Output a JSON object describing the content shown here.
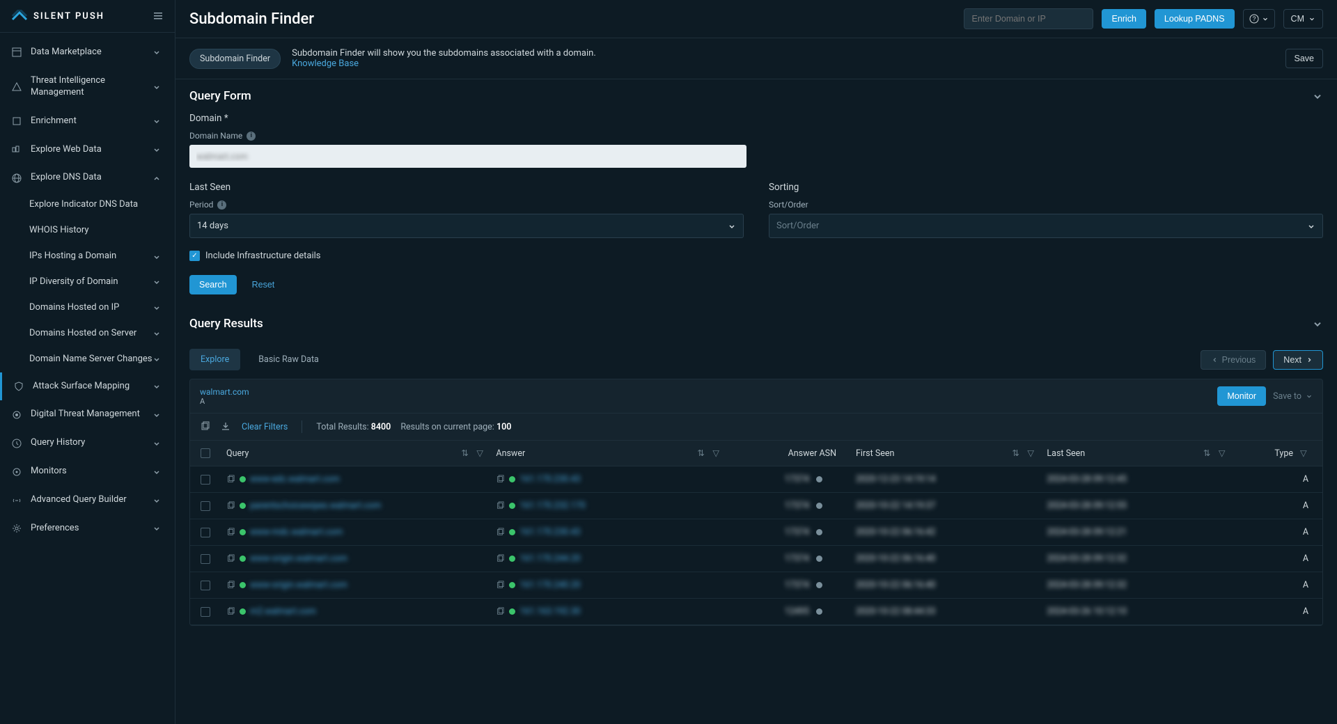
{
  "brand": "SILENT PUSH",
  "header": {
    "title": "Subdomain Finder",
    "search_placeholder": "Enter Domain or IP",
    "enrich": "Enrich",
    "lookup": "Lookup PADNS",
    "user": "CM"
  },
  "sidebar": {
    "items": [
      {
        "label": "Data Marketplace"
      },
      {
        "label": "Threat Intelligence Management"
      },
      {
        "label": "Enrichment"
      },
      {
        "label": "Explore Web Data"
      },
      {
        "label": "Explore DNS Data",
        "expanded": true,
        "children": [
          {
            "label": "Explore Indicator DNS Data"
          },
          {
            "label": "WHOIS History"
          },
          {
            "label": "IPs Hosting a Domain"
          },
          {
            "label": "IP Diversity of Domain"
          },
          {
            "label": "Domains Hosted on IP"
          },
          {
            "label": "Domains Hosted on Server"
          },
          {
            "label": "Domain Name Server Changes"
          }
        ]
      },
      {
        "label": "Attack Surface Mapping"
      },
      {
        "label": "Digital Threat Management"
      },
      {
        "label": "Query History"
      },
      {
        "label": "Monitors"
      },
      {
        "label": "Advanced Query Builder"
      },
      {
        "label": "Preferences"
      }
    ]
  },
  "info": {
    "pill": "Subdomain Finder",
    "text": "Subdomain Finder will show you the subdomains associated with a domain.",
    "kb": "Knowledge Base",
    "save": "Save"
  },
  "form": {
    "head": "Query Form",
    "domain_group": "Domain *",
    "domain_label": "Domain Name",
    "domain_value": "walmart.com",
    "last_seen_group": "Last Seen",
    "period_label": "Period",
    "period_value": "14 days",
    "sorting_group": "Sorting",
    "sort_label": "Sort/Order",
    "sort_placeholder": "Sort/Order",
    "include_infra": "Include Infrastructure details",
    "search": "Search",
    "reset": "Reset"
  },
  "results": {
    "head": "Query Results",
    "tabs": {
      "explore": "Explore",
      "raw": "Basic Raw Data"
    },
    "pager": {
      "prev": "Previous",
      "next": "Next"
    },
    "query_domain": "walmart.com",
    "query_type": "A",
    "monitor": "Monitor",
    "saveto": "Save to",
    "clear_filters": "Clear Filters",
    "total_label": "Total Results:",
    "total_value": "8400",
    "page_label": "Results on current page:",
    "page_value": "100",
    "columns": {
      "query": "Query",
      "answer": "Answer",
      "asn": "Answer ASN",
      "first": "First Seen",
      "last": "Last Seen",
      "type": "Type"
    },
    "rows": [
      {
        "query": "www-edc.walmart.com",
        "answer": "161.170.230.43",
        "asn": "17374",
        "first": "2020-12-23 14:19:14",
        "last": "2024-03-28 09:12:45",
        "type": "A"
      },
      {
        "query": "parentschoicewipes.walmart.com",
        "answer": "161.170.232.170",
        "asn": "17374",
        "first": "2020-10-22 14:19:37",
        "last": "2024-03-28 09:12:55",
        "type": "A"
      },
      {
        "query": "www-mdc.walmart.com",
        "answer": "161.170.230.43",
        "asn": "17374",
        "first": "2020-10-22 06:16:42",
        "last": "2024-03-28 09:12:21",
        "type": "A"
      },
      {
        "query": "www-origin.walmart.com",
        "answer": "161.170.244.20",
        "asn": "17374",
        "first": "2020-10-22 06:16:40",
        "last": "2024-03-28 09:12:32",
        "type": "A"
      },
      {
        "query": "www-origin.walmart.com",
        "answer": "161.170.240.20",
        "asn": "17374",
        "first": "2020-10-22 06:16:40",
        "last": "2024-03-28 09:12:32",
        "type": "A"
      },
      {
        "query": "m2.walmart.com",
        "answer": "161.163.192.30",
        "asn": "12495",
        "first": "2020-10-22 08:44:33",
        "last": "2024-03-26 10:12:10",
        "type": "A"
      }
    ]
  }
}
